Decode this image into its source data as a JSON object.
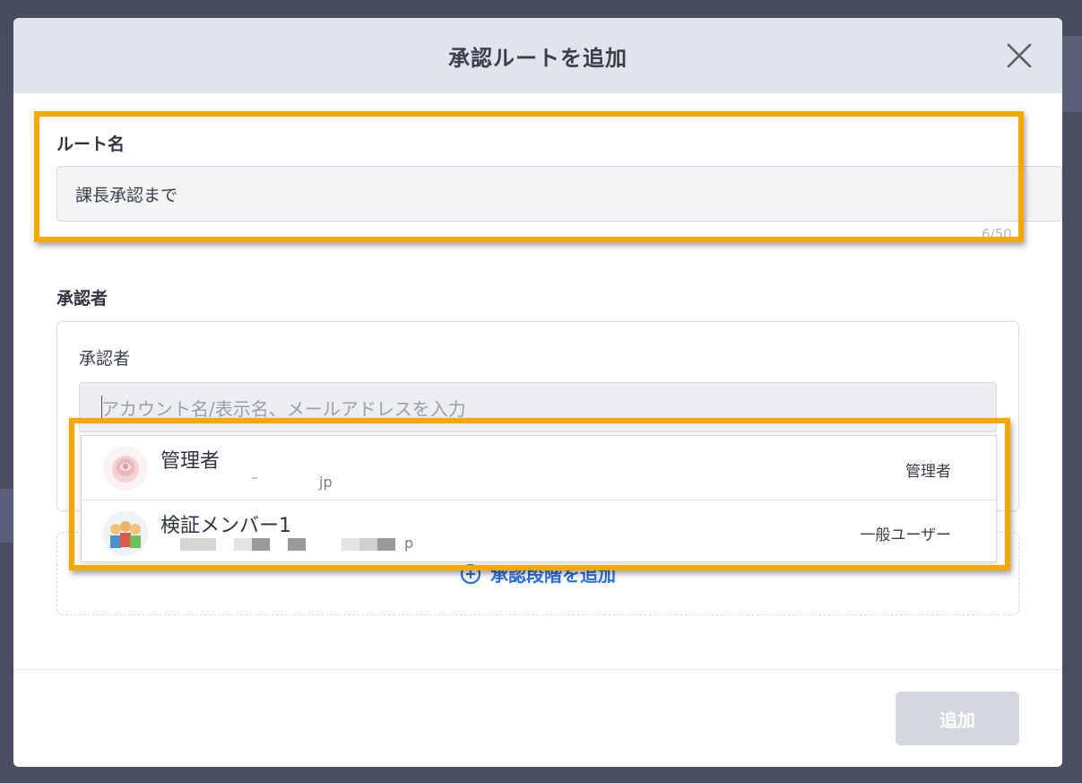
{
  "modal": {
    "title": "承認ルートを追加",
    "close_icon": "close-icon"
  },
  "route_name": {
    "label": "ルート名",
    "value": "課長承認まで",
    "char_count": "6/50"
  },
  "approvers": {
    "section_label": "承認者",
    "field_label": "承認者",
    "search_placeholder": "アカウント名/表示名、メールアドレスを入力"
  },
  "dropdown": {
    "options": [
      {
        "name": "管理者",
        "email_visible": "jp",
        "role": "管理者",
        "avatar_icon": "rose-avatar-icon"
      },
      {
        "name": "検証メンバー1",
        "email_visible": "p",
        "role": "一般ユーザー",
        "avatar_icon": "group-photo-avatar-icon"
      }
    ]
  },
  "add_stage": {
    "label": "承認段階を追加",
    "icon": "plus-circle-icon"
  },
  "footer": {
    "submit_label": "追加"
  },
  "colors": {
    "highlight": "#f5a800",
    "accent_blue": "#2b6fd6",
    "header_bg": "#e1e4ec",
    "disabled_button": "#d4d7de"
  }
}
